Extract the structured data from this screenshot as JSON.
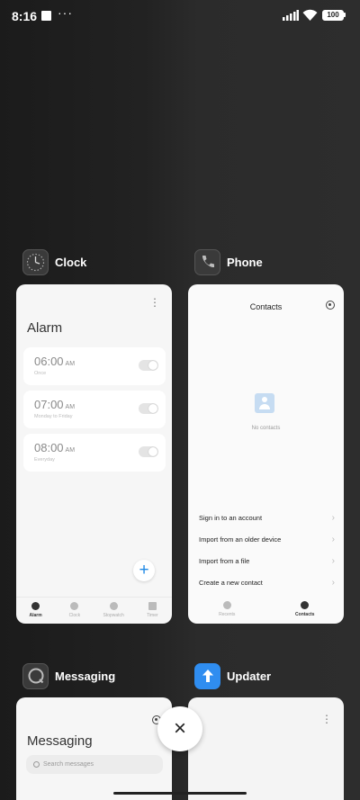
{
  "status_bar": {
    "time": "8:16",
    "battery": "100",
    "icons": [
      "square-notification-icon",
      "more-notifications-icon",
      "signal-icon",
      "wifi-icon",
      "battery-icon"
    ]
  },
  "recents": [
    {
      "app": "Clock",
      "icon": "clock-app-icon",
      "screen": {
        "title": "Alarm",
        "alarms": [
          {
            "time": "06:00",
            "period": "AM",
            "sub": "Once",
            "enabled": false
          },
          {
            "time": "07:00",
            "period": "AM",
            "sub": "Monday to Friday",
            "enabled": false
          },
          {
            "time": "08:00",
            "period": "AM",
            "sub": "Everyday",
            "enabled": false
          }
        ],
        "fab_icon": "+",
        "nav": [
          {
            "label": "Alarm",
            "active": true
          },
          {
            "label": "Clock",
            "active": false
          },
          {
            "label": "Stopwatch",
            "active": false
          },
          {
            "label": "Timer",
            "active": false
          }
        ]
      }
    },
    {
      "app": "Phone",
      "icon": "phone-app-icon",
      "screen": {
        "title": "Contacts",
        "empty_text": "No contacts",
        "actions": [
          "Sign in to an account",
          "Import from an older device",
          "Import from a file",
          "Create a new contact"
        ],
        "nav": [
          {
            "label": "Recents",
            "active": false
          },
          {
            "label": "Contacts",
            "active": true
          }
        ]
      }
    },
    {
      "app": "Messaging",
      "icon": "messaging-app-icon",
      "screen": {
        "title": "Messaging",
        "search_placeholder": "Search messages"
      }
    },
    {
      "app": "Updater",
      "icon": "updater-app-icon",
      "screen": {}
    }
  ],
  "close_label": "×",
  "colors": {
    "accent": "#1e88e5",
    "updater_icon": "#2f8df0"
  }
}
